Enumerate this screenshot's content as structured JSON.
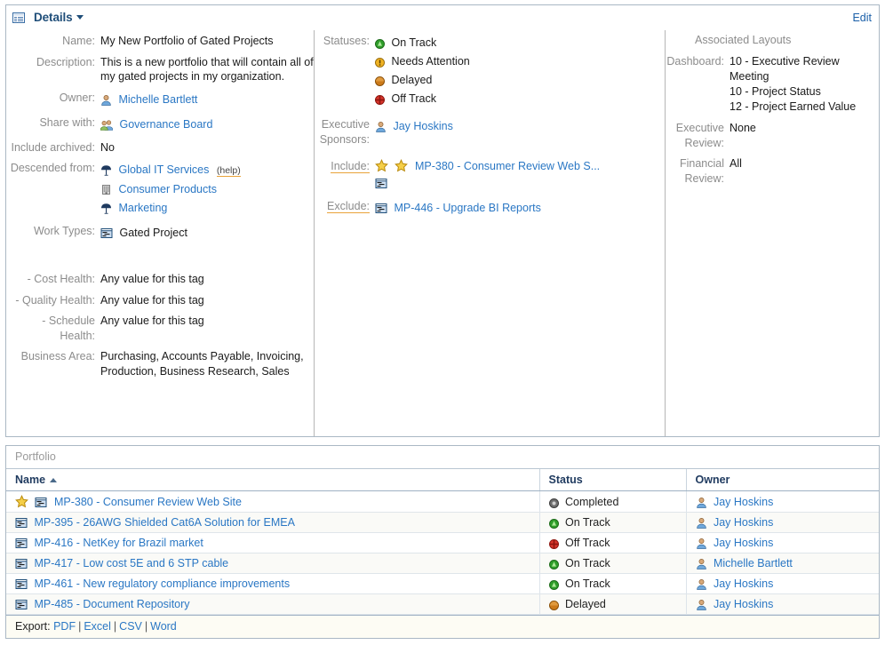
{
  "header": {
    "title": "Details",
    "edit_label": "Edit",
    "panel_icon": "grid-table-icon",
    "caret_icon": "chevron-down-icon"
  },
  "details": {
    "left": [
      {
        "label": "Name:",
        "value": "My New Portfolio of Gated Projects",
        "type": "text"
      },
      {
        "label": "Description:",
        "value": "This is a new portfolio that will contain all of my gated projects in my organization.",
        "type": "text"
      },
      {
        "label": "Owner:",
        "type": "links",
        "items": [
          {
            "text": "Michelle Bartlett",
            "icon": "user-icon"
          }
        ]
      },
      {
        "label": "Share with:",
        "type": "links",
        "items": [
          {
            "text": "Governance Board",
            "icon": "group-icon"
          }
        ]
      },
      {
        "label": "Include archived:",
        "value": "No",
        "type": "text"
      },
      {
        "label": "Descended from:",
        "type": "links",
        "items": [
          {
            "text": "Global IT Services",
            "icon": "organization-icon",
            "help": "(help)"
          },
          {
            "text": "Consumer Products",
            "icon": "division-icon"
          },
          {
            "text": "Marketing",
            "icon": "organization-icon"
          }
        ]
      },
      {
        "label": "Work Types:",
        "type": "plain-icon",
        "items": [
          {
            "text": "Gated Project",
            "icon": "project-icon"
          }
        ]
      },
      {
        "label": "",
        "value": "",
        "type": "spacer"
      },
      {
        "label": "- Cost Health:",
        "value": "Any value for this tag",
        "type": "text"
      },
      {
        "label": "- Quality Health:",
        "value": "Any value for this tag",
        "type": "text"
      },
      {
        "label": "- Schedule Health:",
        "value": "Any value for this tag",
        "type": "text"
      },
      {
        "label": "Business Area:",
        "value": "Purchasing, Accounts Payable, Invoicing, Production, Business Research, Sales",
        "type": "text"
      }
    ],
    "statuses": {
      "label": "Statuses:",
      "items": [
        {
          "text": "On Track",
          "icon": "status-on-track-icon",
          "color": "#33a02c"
        },
        {
          "text": "Needs Attention",
          "icon": "status-needs-attention-icon",
          "color": "#e8a317"
        },
        {
          "text": "Delayed",
          "icon": "status-delayed-icon",
          "color": "#cc7a1a"
        },
        {
          "text": "Off Track",
          "icon": "status-off-track-icon",
          "color": "#d9352c"
        }
      ]
    },
    "executive_sponsors": {
      "label": "Executive Sponsors:",
      "items": [
        {
          "text": "Jay Hoskins",
          "icon": "user-icon"
        }
      ]
    },
    "include": {
      "label": "Include:",
      "icons": [
        "star-icon",
        "star-icon",
        "project-icon"
      ],
      "text": "MP-380 - Consumer Review Web S..."
    },
    "exclude": {
      "label": "Exclude:",
      "icons": [
        "project-icon"
      ],
      "text": "MP-446 - Upgrade BI Reports"
    },
    "associated_layouts": {
      "title": "Associated Layouts",
      "rows": [
        {
          "label": "Dashboard:",
          "values": [
            "10 - Executive Review Meeting",
            "10 - Project Status",
            "12 - Project Earned Value"
          ]
        },
        {
          "label": "Executive Review:",
          "values": [
            "None"
          ]
        },
        {
          "label": "Financial Review:",
          "values": [
            "All"
          ]
        }
      ]
    }
  },
  "portfolio": {
    "caption": "Portfolio",
    "columns": [
      "Name",
      "Status",
      "Owner"
    ],
    "sort_column": "Name",
    "sort_direction": "ascending",
    "rows": [
      {
        "starred": true,
        "name": "MP-380 - Consumer Review Web Site",
        "status": "Completed",
        "status_icon": "status-completed-icon",
        "owner": "Jay Hoskins"
      },
      {
        "starred": false,
        "name": "MP-395 - 26AWG Shielded Cat6A Solution for EMEA",
        "status": "On Track",
        "status_icon": "status-on-track-icon",
        "owner": "Jay Hoskins"
      },
      {
        "starred": false,
        "name": "MP-416 - NetKey for Brazil market",
        "status": "Off Track",
        "status_icon": "status-off-track-icon",
        "owner": "Jay Hoskins"
      },
      {
        "starred": false,
        "name": "MP-417 - Low cost 5E and 6 STP cable",
        "status": "On Track",
        "status_icon": "status-on-track-icon",
        "owner": "Michelle Bartlett"
      },
      {
        "starred": false,
        "name": "MP-461 - New regulatory compliance improvements",
        "status": "On Track",
        "status_icon": "status-on-track-icon",
        "owner": "Jay Hoskins"
      },
      {
        "starred": false,
        "name": "MP-485 - Document Repository",
        "status": "Delayed",
        "status_icon": "status-delayed-icon",
        "owner": "Jay Hoskins"
      }
    ],
    "export": {
      "prefix": "Export:",
      "options": [
        "PDF",
        "Excel",
        "CSV",
        "Word"
      ]
    }
  },
  "colors": {
    "link": "#2a77c4",
    "label": "#8c8c8c",
    "title": "#1f4e79",
    "panel_border": "#aab8c4",
    "status_green": "#33a02c",
    "status_amber": "#e8a317",
    "status_orange": "#cc7a1a",
    "status_red": "#d9352c",
    "status_gray": "#6e6e6e",
    "help_underline": "#e9a33a"
  }
}
